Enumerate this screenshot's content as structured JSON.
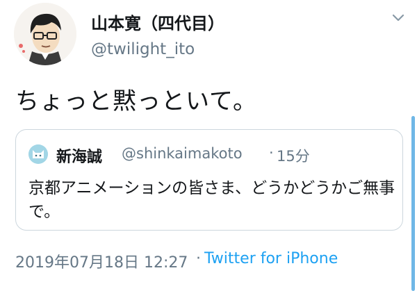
{
  "tweet": {
    "author": {
      "display_name": "山本寛（四代目）",
      "handle": "@twilight_ito",
      "avatar_icon": "cartoon-avatar-icon"
    },
    "menu_icon": "chevron-down-icon",
    "text": "ちょっと黙っといて。",
    "quoted": {
      "author_name": "新海誠",
      "handle": "@shinkaimakoto",
      "separator": "·",
      "time": "15分",
      "avatar_icon": "cat-avatar-icon",
      "text": "京都アニメーションの皆さま、どうかどうかご無事で。"
    },
    "meta": {
      "timestamp": "2019年07月18日 12:27",
      "separator": "·",
      "source": "Twitter for iPhone"
    }
  },
  "colors": {
    "text": "#14171a",
    "secondary": "#657786",
    "link": "#1da1f2",
    "border": "#ccd6dd",
    "scrollbar": "#6fb7e6"
  }
}
